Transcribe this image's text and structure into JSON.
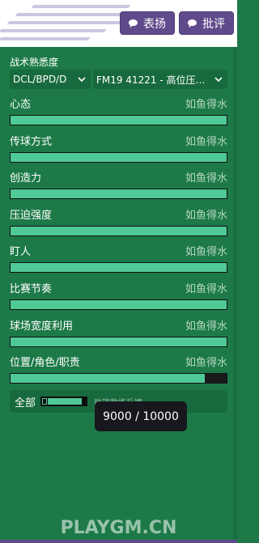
{
  "header": {
    "praise_label": "表扬",
    "criticize_label": "批评"
  },
  "tactical": {
    "label": "战术熟悉度",
    "position_select": "DCL/BPD/D",
    "tactic_select": "FM19 41221 - 高位压迫E..."
  },
  "attributes": [
    {
      "name": "心态",
      "status": "如鱼得水",
      "progress": 1.0
    },
    {
      "name": "传球方式",
      "status": "如鱼得水",
      "progress": 1.0
    },
    {
      "name": "创造力",
      "status": "如鱼得水",
      "progress": 1.0
    },
    {
      "name": "压迫强度",
      "status": "如鱼得水",
      "progress": 1.0
    },
    {
      "name": "盯人",
      "status": "如鱼得水",
      "progress": 1.0
    },
    {
      "name": "比赛节奏",
      "status": "如鱼得水",
      "progress": 1.0
    },
    {
      "name": "球场宽度利用",
      "status": "如鱼得水",
      "progress": 1.0
    },
    {
      "name": "位置/角色/职责",
      "status": "如鱼得水",
      "progress": 0.9
    }
  ],
  "summary": {
    "all_label": "全部",
    "hint": "助理教练反馈",
    "progress": 0.9
  },
  "tooltip": {
    "text": "9000 / 10000"
  },
  "watermark": "PLAYGM.CN",
  "colors": {
    "background": "#1d7a48",
    "bar_fill": "#4fc995",
    "button": "#5f4b8b",
    "tooltip": "#16181d"
  }
}
